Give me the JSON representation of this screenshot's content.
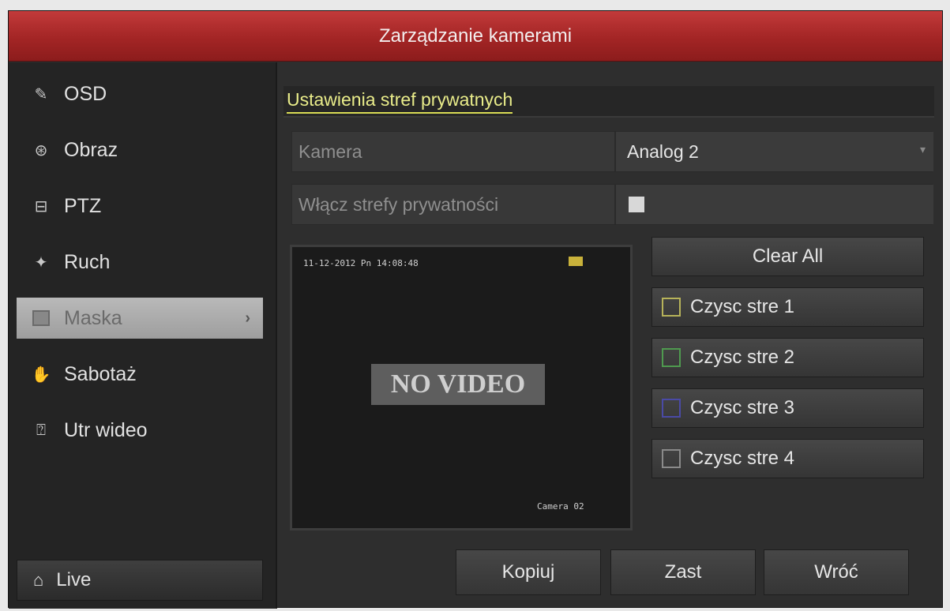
{
  "window": {
    "title": "Zarządzanie kamerami"
  },
  "sidebar": {
    "items": [
      {
        "label": "OSD",
        "icon": "edit-icon"
      },
      {
        "label": "Obraz",
        "icon": "image-settings-icon"
      },
      {
        "label": "PTZ",
        "icon": "ptz-icon"
      },
      {
        "label": "Ruch",
        "icon": "motion-icon"
      },
      {
        "label": "Maska",
        "icon": "mask-icon",
        "active": true
      },
      {
        "label": "Sabotaż",
        "icon": "tamper-hand-icon"
      },
      {
        "label": "Utr wideo",
        "icon": "video-loss-icon"
      }
    ],
    "live_label": "Live"
  },
  "main": {
    "section_title": "Ustawienia stref prywatnych",
    "camera": {
      "label": "Kamera",
      "value": "Analog 2"
    },
    "enable_privacy": {
      "label": "Włącz strefy prywatności",
      "checked": true
    },
    "preview": {
      "timestamp": "11-12-2012 Pn 14:08:48",
      "no_video": "NO VIDEO",
      "camera_label": "Camera 02"
    },
    "clear_all_label": "Clear All",
    "zones": [
      {
        "label": "Czysc stre 1",
        "color": "#b7b35a"
      },
      {
        "label": "Czysc stre 2",
        "color": "#4f9a4f"
      },
      {
        "label": "Czysc stre 3",
        "color": "#4a4aa6"
      },
      {
        "label": "Czysc stre 4",
        "color": "#8a8a8a"
      }
    ],
    "actions": {
      "copy": "Kopiuj",
      "apply": "Zast",
      "back": "Wróć"
    }
  },
  "colors": {
    "title_bar": "#a32525",
    "section_title": "#e9ec8a",
    "active_item": "#b9b9b9"
  }
}
